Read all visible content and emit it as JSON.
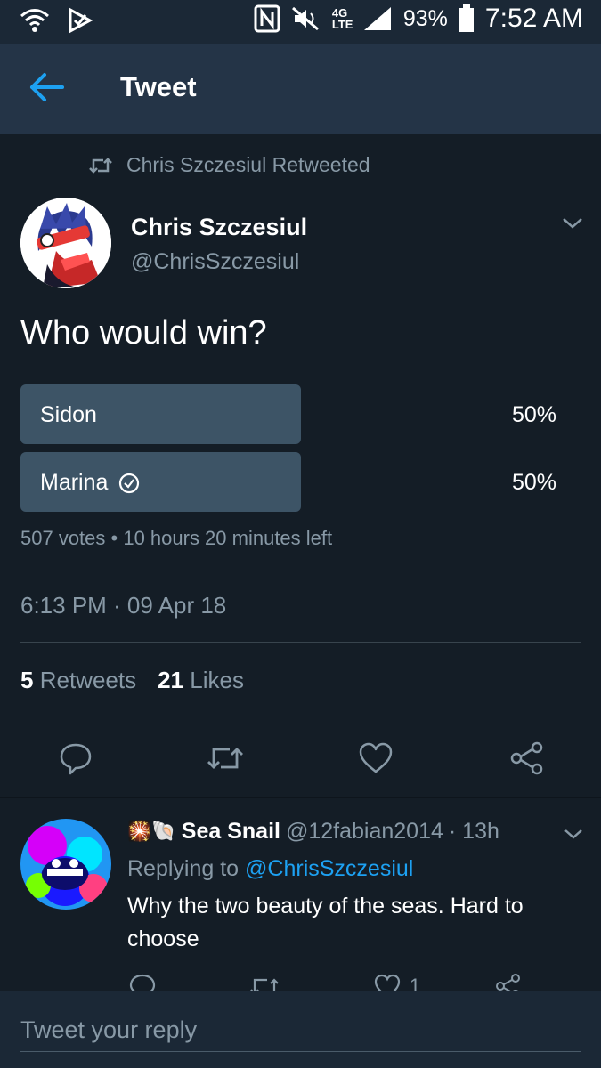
{
  "status_bar": {
    "battery": "93%",
    "time": "7:52 AM",
    "network": "4G LTE"
  },
  "header": {
    "title": "Tweet"
  },
  "retweet_context": "Chris Szczesiul Retweeted",
  "tweet": {
    "author_name": "Chris Szczesiul",
    "author_handle": "@ChrisSzczesiul",
    "text": "Who would win?",
    "poll": {
      "options": [
        {
          "label": "Sidon",
          "percent": "50%",
          "fraction": 0.5,
          "selected": false
        },
        {
          "label": "Marina",
          "percent": "50%",
          "fraction": 0.5,
          "selected": true
        }
      ],
      "meta": "507 votes • 10 hours 20 minutes left"
    },
    "timestamp": "6:13 PM · 09 Apr 18",
    "retweets_count": "5",
    "retweets_label": "Retweets",
    "likes_count": "21",
    "likes_label": "Likes"
  },
  "reply": {
    "emoji_prefix": "🎇🐚",
    "author_name": "Sea Snail",
    "author_handle": "@12fabian2014",
    "time": "· 13h",
    "replying_prefix": "Replying to ",
    "replying_to": "@ChrisSzczesiul",
    "text": "Why the two beauty of the seas.  Hard to choose",
    "like_count": "1"
  },
  "compose": {
    "placeholder": "Tweet your reply"
  },
  "colors": {
    "background": "#141d26",
    "header": "#243447",
    "poll_bar": "#3d5466",
    "muted": "#8899a6",
    "link": "#1da1f2"
  }
}
